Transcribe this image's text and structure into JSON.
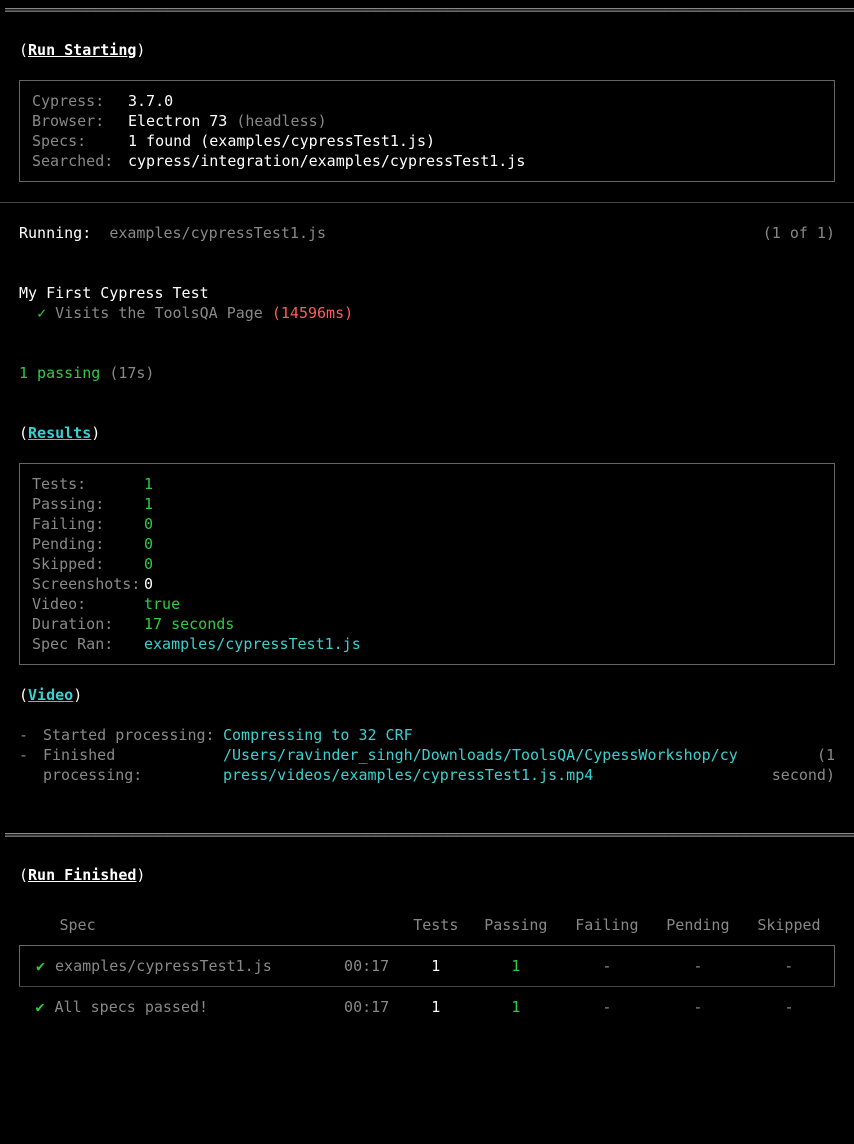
{
  "runStarting": {
    "header": "Run Starting",
    "cypressLabel": "Cypress:",
    "cypressVal": "3.7.0",
    "browserLabel": "Browser:",
    "browserVal": "Electron 73",
    "browserNote": "(headless)",
    "specsLabel": "Specs:",
    "specsVal": "1 found (examples/cypressTest1.js)",
    "searchedLabel": "Searched:",
    "searchedVal": "cypress/integration/examples/cypressTest1.js"
  },
  "running": {
    "label": "Running:",
    "file": "examples/cypressTest1.js",
    "count": "(1 of 1)"
  },
  "test": {
    "suite": "My First Cypress Test",
    "check": "✓",
    "name": "Visits the ToolsQA Page",
    "duration": "(14596ms)"
  },
  "passing": {
    "text": "1 passing",
    "time": "(17s)"
  },
  "results": {
    "header": "Results",
    "rows": [
      {
        "label": "Tests:",
        "val": "1",
        "cls": "val-green"
      },
      {
        "label": "Passing:",
        "val": "1",
        "cls": "val-green"
      },
      {
        "label": "Failing:",
        "val": "0",
        "cls": "val-green"
      },
      {
        "label": "Pending:",
        "val": "0",
        "cls": "val-green"
      },
      {
        "label": "Skipped:",
        "val": "0",
        "cls": "val-green"
      },
      {
        "label": "Screenshots:",
        "val": "0",
        "cls": "val-white"
      },
      {
        "label": "Video:",
        "val": "true",
        "cls": "val-green"
      },
      {
        "label": "Duration:",
        "val": "17 seconds",
        "cls": "val-green"
      },
      {
        "label": "Spec Ran:",
        "val": "examples/cypressTest1.js",
        "cls": "val-cyan"
      }
    ]
  },
  "video": {
    "header": "Video",
    "dash": "-",
    "startedLabel": "Started processing:",
    "startedVal": "Compressing to 32 CRF",
    "finishedLabel": "Finished processing:",
    "finishedVal": "/Users/ravinder_singh/Downloads/ToolsQA/CypessWorkshop/cypress/videos/examples/cypressTest1.js.mp4",
    "finishedTime": "(1 second)"
  },
  "runFinished": {
    "header": "Run Finished",
    "cols": {
      "spec": "Spec",
      "tests": "Tests",
      "passing": "Passing",
      "failing": "Failing",
      "pending": "Pending",
      "skipped": "Skipped"
    },
    "row": {
      "check": "✔",
      "spec": "examples/cypressTest1.js",
      "time": "00:17",
      "tests": "1",
      "passing": "1",
      "failing": "-",
      "pending": "-",
      "skipped": "-"
    },
    "summary": {
      "check": "✔",
      "label": "All specs passed!",
      "time": "00:17",
      "tests": "1",
      "passing": "1",
      "failing": "-",
      "pending": "-",
      "skipped": "-"
    }
  },
  "rule": "════════════════════════════════════════════════════════════════════════════════════════════════════════════"
}
